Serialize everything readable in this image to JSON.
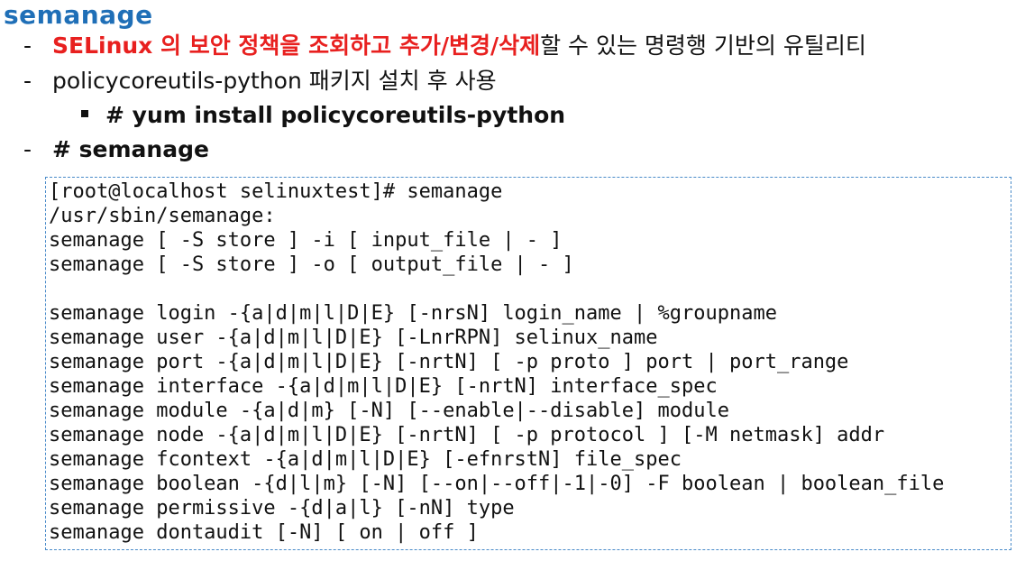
{
  "title": "semanage",
  "bullets": [
    {
      "marker": "-",
      "highlight": "SELinux 의 보안 정책을 조회하고 추가/변경/삭제",
      "rest": "할 수 있는 명령행 기반의 유틸리티"
    },
    {
      "marker": "-",
      "text": "policycoreutils-python 패키지 설치 후 사용"
    },
    {
      "marker": "▪",
      "text": "# yum install policycoreutils-python"
    },
    {
      "marker": "-",
      "text": "# semanage"
    }
  ],
  "terminal": {
    "lines": [
      "[root@localhost selinuxtest]# semanage",
      "/usr/sbin/semanage:",
      "semanage [ -S store ] -i [ input_file | - ]",
      "semanage [ -S store ] -o [ output_file | - ]",
      "",
      "semanage login -{a|d|m|l|D|E} [-nrsN] login_name | %groupname",
      "semanage user -{a|d|m|l|D|E} [-LnrRPN] selinux_name",
      "semanage port -{a|d|m|l|D|E} [-nrtN] [ -p proto ] port | port_range",
      "semanage interface -{a|d|m|l|D|E} [-nrtN] interface_spec",
      "semanage module -{a|d|m} [-N] [--enable|--disable] module",
      "semanage node -{a|d|m|l|D|E} [-nrtN] [ -p protocol ] [-M netmask] addr",
      "semanage fcontext -{a|d|m|l|D|E} [-efnrstN] file_spec",
      "semanage boolean -{d|l|m} [-N] [--on|--off|-1|-0] -F boolean | boolean_file",
      "semanage permissive -{d|a|l} [-nN] type",
      "semanage dontaudit [-N] [ on | off ]"
    ]
  }
}
